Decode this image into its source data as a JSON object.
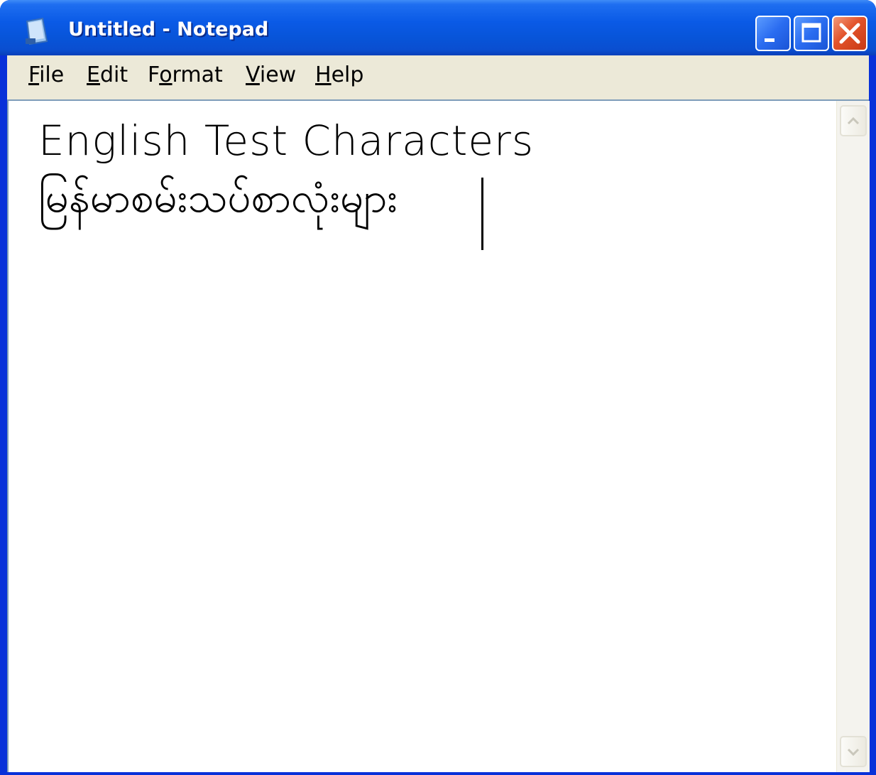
{
  "window": {
    "title": "Untitled - Notepad",
    "icon": "notepad-icon"
  },
  "controls": {
    "minimize_icon": "minimize-icon",
    "maximize_icon": "maximize-icon",
    "close_icon": "close-icon"
  },
  "menu": {
    "items": [
      {
        "label": "File",
        "accel": "F",
        "rest": "ile"
      },
      {
        "label": "Edit",
        "accel": "E",
        "rest": "dit"
      },
      {
        "label": "Format",
        "pre": "F",
        "accel": "o",
        "rest": "rmat"
      },
      {
        "label": "View",
        "accel": "V",
        "rest": "iew"
      },
      {
        "label": "Help",
        "accel": "H",
        "rest": "elp"
      }
    ]
  },
  "editor": {
    "lines": [
      "English Test Characters",
      "မြန်မာစမ်းသပ်စာလုံးများ"
    ]
  },
  "scrollbar": {
    "up_icon": "chevron-up-icon",
    "down_icon": "chevron-down-icon"
  },
  "colors": {
    "titlebar": "#0a5ae6",
    "menubar": "#ece9d8",
    "close_button": "#e2522a"
  }
}
